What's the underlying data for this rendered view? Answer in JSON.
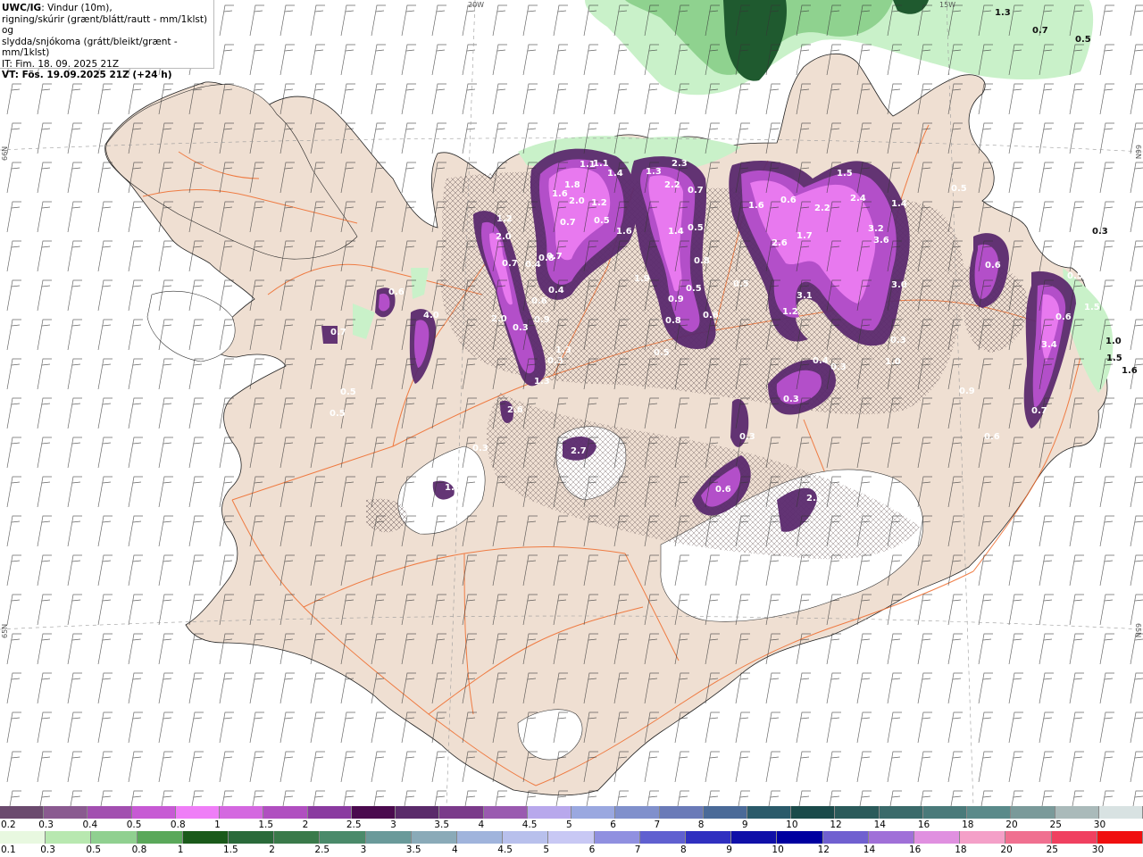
{
  "header": {
    "line1_bold": "UWC/IG",
    "line1_rest": ": Vindur (10m),",
    "line2": "rigning/skúrir (grænt/blátt/rautt - mm/1klst) og",
    "line3": "slydda/snjókoma (grátt/bleikt/grænt - mm/1klst)",
    "line4": "IT: Fim. 18. 09. 2025 21Z",
    "line5": "VT: Fös. 19.09.2025 21Z (+24 h)"
  },
  "edge_labels": {
    "top": "20W",
    "top_right": "15W",
    "left_upper": "66N",
    "left_lower": "65N",
    "right_upper": "66N",
    "right_lower": "65N"
  },
  "colors": {
    "land": "#efdfd2",
    "roads": "#ef6a2a",
    "snow_purple_dark": "#5b2a6e",
    "snow_purple": "#b34fc9",
    "snow_pink": "#e879ef",
    "rain_green_light": "#c9f1c9",
    "rain_green": "#5fae6a",
    "rain_green_dark": "#1f5a2f"
  },
  "precip_values": [
    "1.1",
    "1.8",
    "1.6",
    "2.0",
    "1.2",
    "1.4",
    "0.7",
    "0.7",
    "0.5",
    "1.6",
    "1.3",
    "2.2",
    "2.3",
    "0.7",
    "1.4",
    "0.5",
    "0.8",
    "0.5",
    "0.9",
    "0.8",
    "0.6",
    "0.5",
    "1.6",
    "0.6",
    "2.6",
    "1.7",
    "2.2",
    "1.5",
    "2.4",
    "3.2",
    "3.6",
    "3.0",
    "3.1",
    "1.2",
    "1.4",
    "1.2",
    "0.7",
    "2.0",
    "0.3",
    "1.0",
    "0.4",
    "0.3",
    "0.5",
    "0.6",
    "0.3",
    "0.5",
    "0.6",
    "1.5",
    "3.4",
    "0.7",
    "1.5",
    "1.6",
    "1.0",
    "4.0",
    "0.6",
    "0.7",
    "0.5",
    "0.5",
    "0.3",
    "2.6",
    "0.9",
    "0.3",
    "1.3",
    "0.3",
    "0.4",
    "1.9",
    "0.6",
    "1.3",
    "0.8",
    "0.4",
    "1.1",
    "2.0",
    "0.5",
    "0.3",
    "0.3",
    "0.6",
    "2.2",
    "2.7",
    "1.3",
    "0.9",
    "0.6",
    "1.3",
    "0.7",
    "0.5"
  ],
  "legend_top": {
    "labels": [
      "0.2",
      "0.3",
      "0.4",
      "0.5",
      "0.8",
      "1",
      "1.5",
      "2",
      "2.5",
      "3",
      "3.5",
      "4",
      "4.5",
      "5",
      "6",
      "7",
      "8",
      "9",
      "10",
      "12",
      "14",
      "16",
      "18",
      "20",
      "25",
      "30"
    ],
    "colors": [
      "#6b4a6e",
      "#8a5a90",
      "#a24fb0",
      "#c75ad4",
      "#ef7ef7",
      "#d468e0",
      "#b04fc0",
      "#8a3aa0",
      "#4a0a4e",
      "#5a2a6a",
      "#7a3a8a",
      "#9a5ab0",
      "#b8a8ec",
      "#9aa8e0",
      "#8090cc",
      "#6a7ab8",
      "#4a6a98",
      "#2a5a6a",
      "#1a4a4a",
      "#2a5a5a",
      "#3a6a6a",
      "#4a7a7a",
      "#5a8a8a",
      "#7a9a9a",
      "#aababa",
      "#d8e2e2"
    ]
  },
  "legend_bottom": {
    "labels": [
      "0.1",
      "0.3",
      "0.5",
      "0.8",
      "1",
      "1.5",
      "2",
      "2.5",
      "3",
      "3.5",
      "4",
      "4.5",
      "5",
      "6",
      "7",
      "8",
      "9",
      "10",
      "12",
      "14",
      "16",
      "18",
      "20",
      "25",
      "30"
    ],
    "colors": [
      "#e8f8e0",
      "#b8e8b0",
      "#90d090",
      "#5aa85a",
      "#1a5a1a",
      "#2a6a3a",
      "#3a7a4a",
      "#4a8a6a",
      "#6a9a9a",
      "#8aaab8",
      "#a0b4dc",
      "#b8c0ec",
      "#c8c8f4",
      "#9090e0",
      "#6060d0",
      "#3030c0",
      "#1010a8",
      "#0000a0",
      "#7060d0",
      "#a070d8",
      "#e090e0",
      "#f4a0c8",
      "#f07090",
      "#f04060",
      "#f01010"
    ]
  }
}
